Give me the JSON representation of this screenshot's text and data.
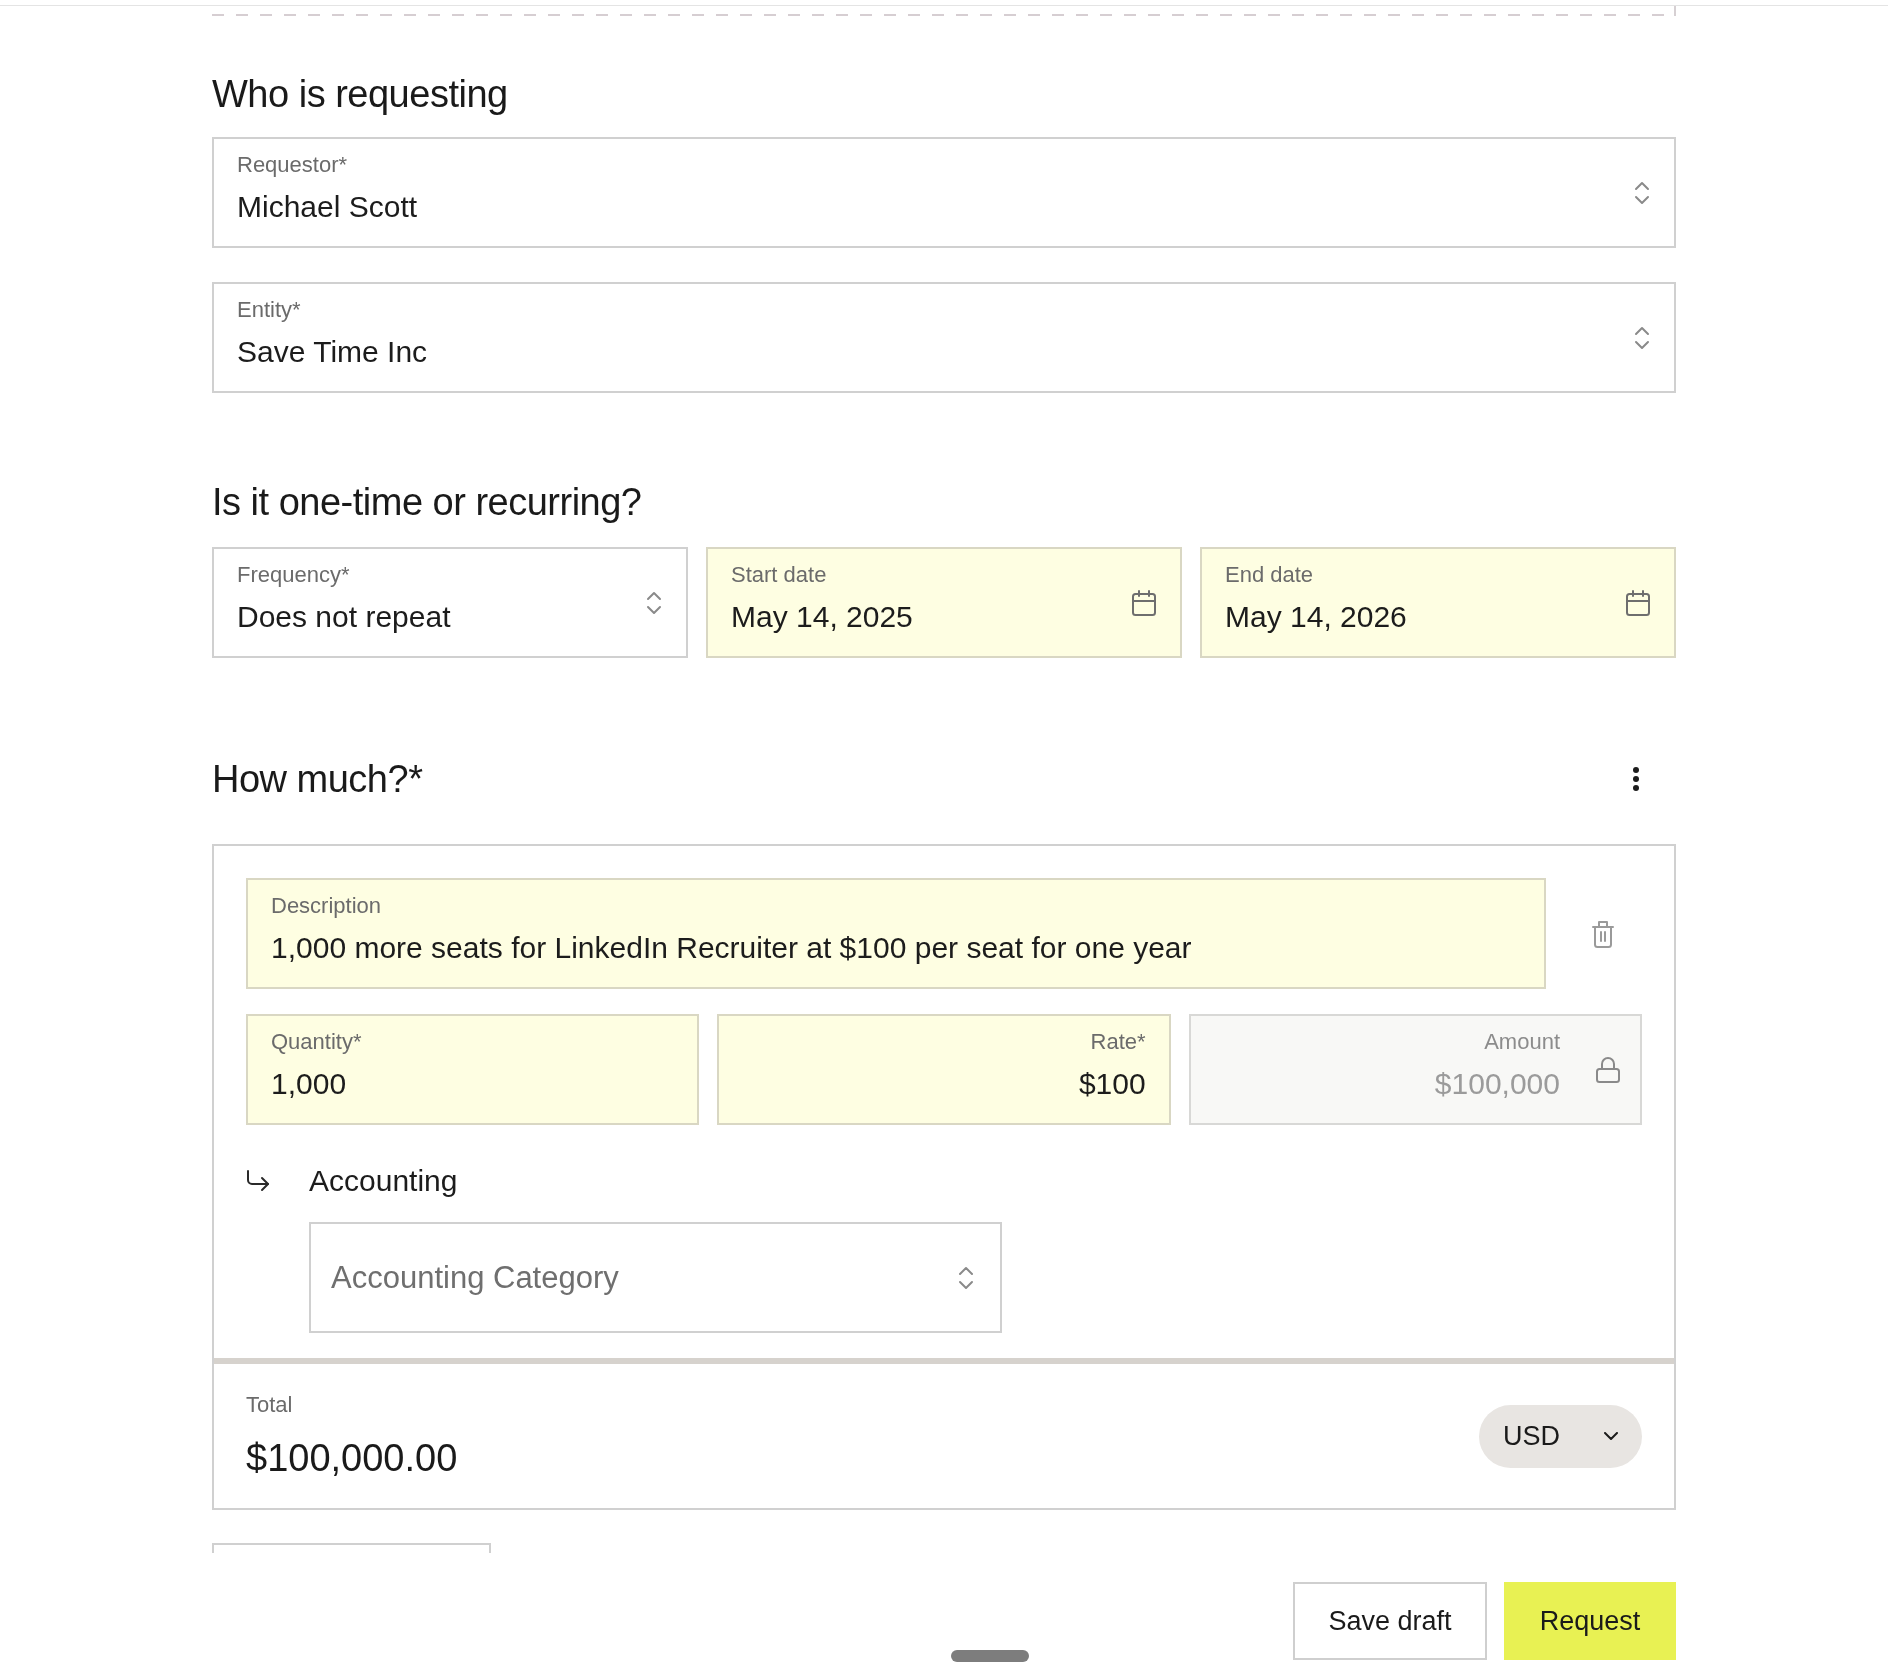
{
  "requesting": {
    "title": "Who is requesting",
    "fields": [
      {
        "kind": "select",
        "label": "Requestor*",
        "value": "Michael Scott",
        "highlighted": false
      },
      {
        "kind": "select",
        "label": "Entity*",
        "value": "Save Time Inc",
        "highlighted": false
      }
    ]
  },
  "schedule": {
    "title": "Is it one-time or recurring?",
    "fields": [
      {
        "kind": "select",
        "label": "Frequency*",
        "value": "Does not repeat",
        "highlighted": false
      },
      {
        "kind": "date",
        "label": "Start date",
        "value": "May 14, 2025",
        "highlighted": true
      },
      {
        "kind": "date",
        "label": "End date",
        "value": "May 14, 2026",
        "highlighted": true
      }
    ]
  },
  "amount": {
    "title": "How much?*",
    "line_items": [
      {
        "description": {
          "label": "Description",
          "value": "1,000 more seats for LinkedIn Recruiter at $100 per seat for one year",
          "highlighted": true
        },
        "quantity": {
          "label": "Quantity*",
          "value": "1,000",
          "highlighted": true
        },
        "rate": {
          "label": "Rate*",
          "value": "$100",
          "highlighted": true
        },
        "amount": {
          "label": "Amount",
          "value": "$100,000",
          "locked": true
        },
        "accounting": {
          "label": "Accounting",
          "category": {
            "placeholder": "Accounting Category"
          }
        }
      }
    ],
    "total": {
      "label": "Total",
      "value": "$100,000.00",
      "currency": "USD"
    }
  },
  "actions": [
    {
      "kind": "secondary",
      "label": "Save draft"
    },
    {
      "kind": "primary",
      "label": "Request"
    }
  ]
}
